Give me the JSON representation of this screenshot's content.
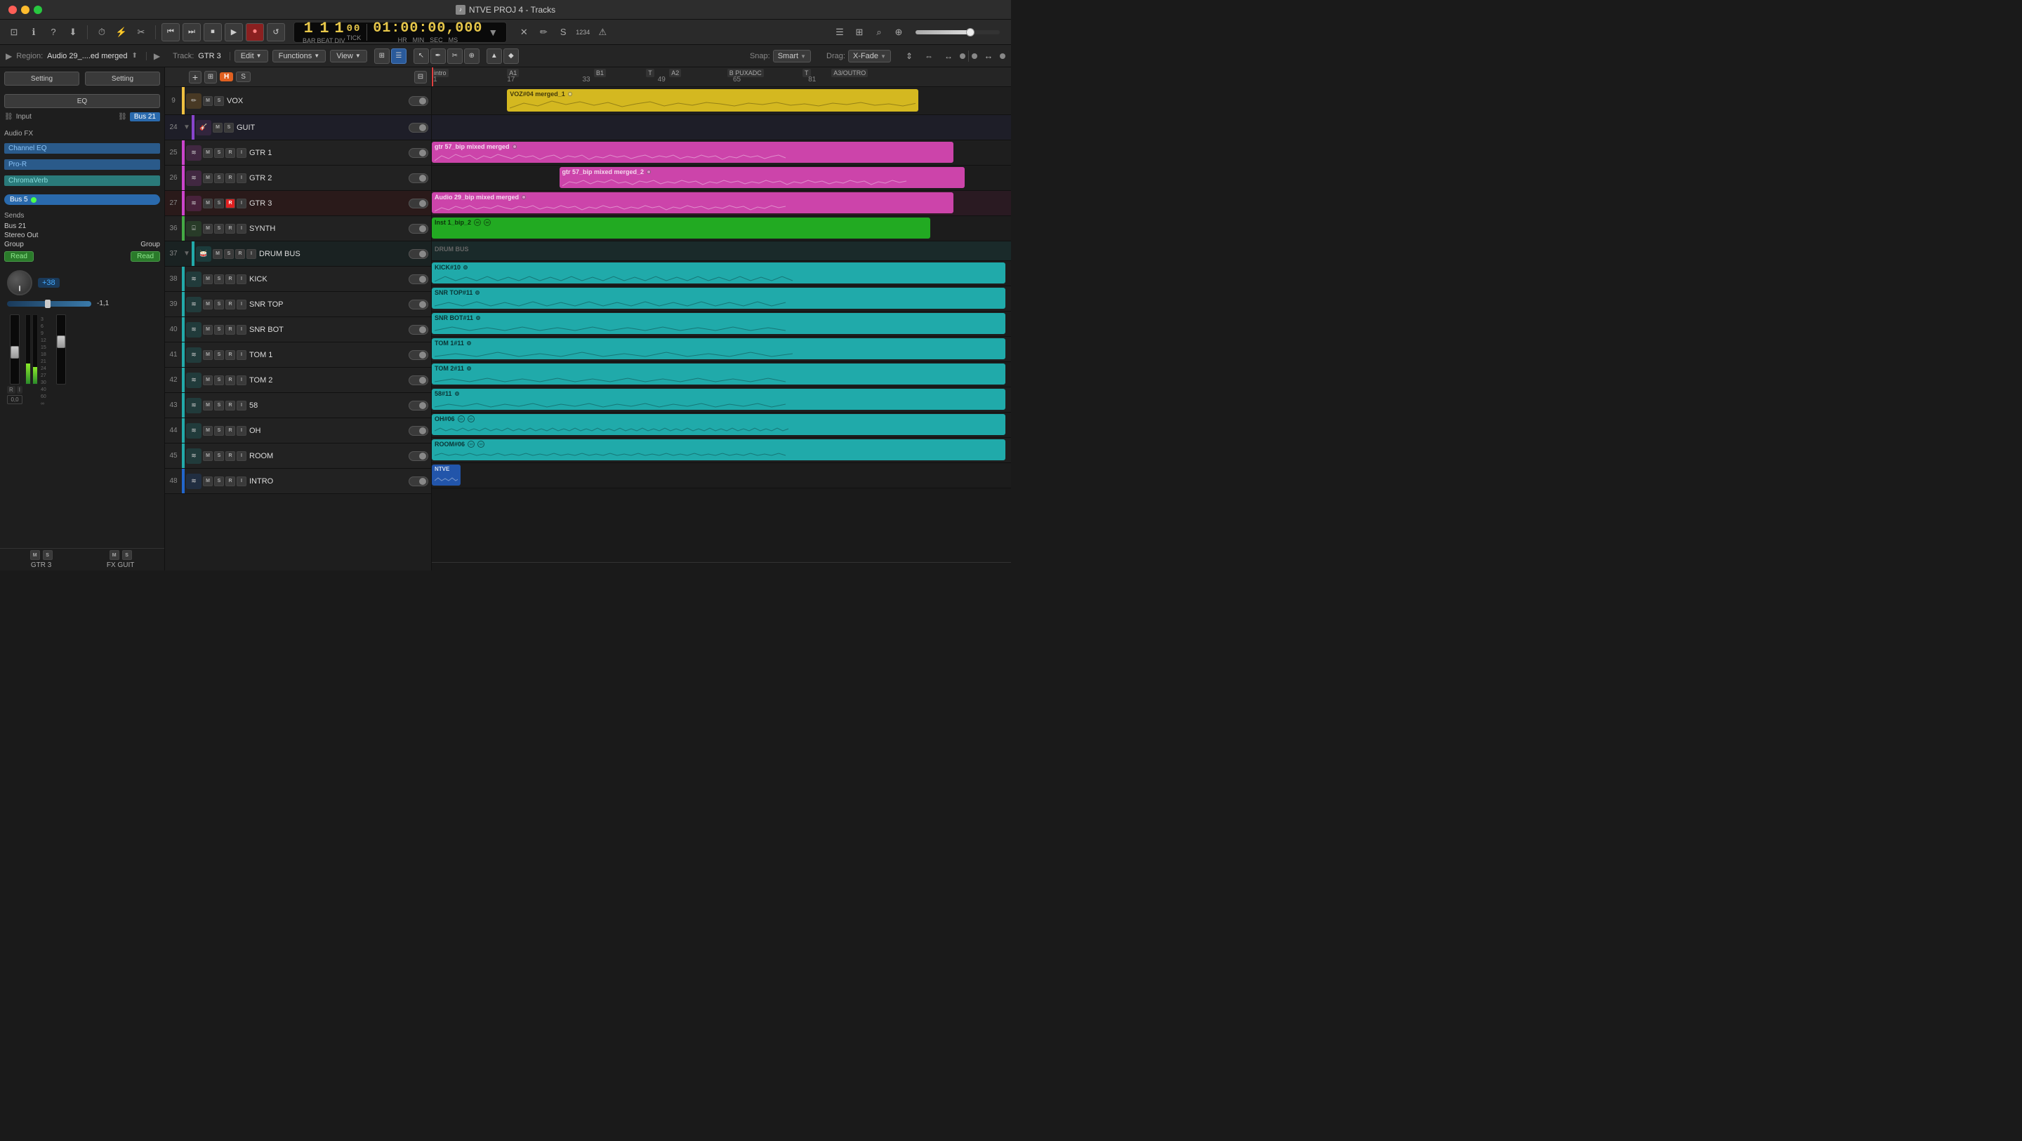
{
  "app": {
    "title": "NTVE PROJ 4 - Tracks"
  },
  "titleBar": {
    "title": "NTVE PROJ 4 - Tracks"
  },
  "transport": {
    "bar": "1",
    "beat": "1",
    "div": "1",
    "tick": "00",
    "time": "01:00:00,000",
    "bar_label": "BAR",
    "beat_label": "BEAT",
    "div_label": "DIV",
    "tick_label": "TICK",
    "hr_label": "HR",
    "min_label": "MIN",
    "sec_label": "SEC",
    "ms_label": "MS"
  },
  "controlBar": {
    "region_label": "Region:",
    "region_name": "Audio 29_....ed merged",
    "track_label": "Track:",
    "track_name": "GTR 3",
    "edit": "Edit",
    "functions": "Functions",
    "view": "View",
    "snap_label": "Snap:",
    "snap_value": "Smart",
    "drag_label": "Drag:",
    "drag_value": "X-Fade"
  },
  "leftPanel": {
    "setting1": "Setting",
    "setting2": "Setting",
    "eq": "EQ",
    "input_label": "Input",
    "bus_21": "Bus 21",
    "audio_fx": "Audio FX",
    "channel_eq": "Channel EQ",
    "pro_r": "Pro-R",
    "chromaverb": "ChromaVerb",
    "bus_5": "Bus 5",
    "sends": "Sends",
    "bus_21_send": "Bus 21",
    "stereo_out": "Stereo Out",
    "group": "Group",
    "group2": "Group",
    "read1": "Read",
    "read2": "Read",
    "gain": "+38",
    "pan": "-1,1",
    "pan2": "0,0",
    "track_bottom": "GTR 3",
    "fx_bottom": "FX GUIT",
    "m": "M",
    "s": "S",
    "m2": "M",
    "s2": "S"
  },
  "trackHeader": {
    "h_label": "H",
    "s_label": "S"
  },
  "tracks": [
    {
      "num": "9",
      "color": "#f0c040",
      "icon_type": "pencil",
      "icon_color": "#f0a030",
      "name": "VOX",
      "mute": false,
      "solo": false,
      "rec": false,
      "input": false,
      "on": false,
      "has_rec": false,
      "has_input": false,
      "has_expand": false
    },
    {
      "num": "24",
      "color": "#8844cc",
      "icon_type": "guitar",
      "icon_color": "#cc66ff",
      "name": "GUIT",
      "mute": false,
      "solo": false,
      "rec": false,
      "input": false,
      "on": false,
      "has_expand": true
    },
    {
      "num": "25",
      "color": "#cc44cc",
      "icon_type": "wave",
      "icon_color": "#cc44cc",
      "name": "GTR 1",
      "mute": false,
      "solo": false,
      "rec": false,
      "input": false,
      "on": false,
      "has_rec": true,
      "has_input": true
    },
    {
      "num": "26",
      "color": "#cc44cc",
      "icon_type": "wave",
      "icon_color": "#cc44cc",
      "name": "GTR 2",
      "mute": false,
      "solo": false,
      "rec": false,
      "input": false,
      "on": false,
      "has_rec": true,
      "has_input": true
    },
    {
      "num": "27",
      "color": "#cc44cc",
      "icon_type": "wave",
      "icon_color": "#cc44cc",
      "name": "GTR 3",
      "mute": false,
      "solo": false,
      "rec": true,
      "input": false,
      "on": false,
      "has_rec": true,
      "has_input": true
    },
    {
      "num": "36",
      "color": "#44aa44",
      "icon_type": "synth",
      "icon_color": "#44aa44",
      "name": "SYNTH",
      "mute": false,
      "solo": false,
      "rec": false,
      "input": false,
      "on": false,
      "has_rec": true,
      "has_input": true
    },
    {
      "num": "37",
      "color": "#22aaaa",
      "icon_type": "drum",
      "icon_color": "#22aaaa",
      "name": "DRUM BUS",
      "mute": false,
      "solo": false,
      "rec": false,
      "input": false,
      "on": false,
      "has_rec": true,
      "has_input": true,
      "has_expand": true
    },
    {
      "num": "38",
      "color": "#22aaaa",
      "icon_type": "wave",
      "icon_color": "#22aaaa",
      "name": "KICK",
      "mute": false,
      "solo": false,
      "rec": false,
      "input": false,
      "on": false,
      "has_rec": true,
      "has_input": true
    },
    {
      "num": "39",
      "color": "#22aaaa",
      "icon_type": "wave",
      "icon_color": "#22aaaa",
      "name": "SNR TOP",
      "mute": false,
      "solo": false,
      "rec": false,
      "input": false,
      "on": false,
      "has_rec": true,
      "has_input": true
    },
    {
      "num": "40",
      "color": "#22aaaa",
      "icon_type": "wave",
      "icon_color": "#22aaaa",
      "name": "SNR BOT",
      "mute": false,
      "solo": false,
      "rec": false,
      "input": false,
      "on": false,
      "has_rec": true,
      "has_input": true
    },
    {
      "num": "41",
      "color": "#22aaaa",
      "icon_type": "wave",
      "icon_color": "#22aaaa",
      "name": "TOM 1",
      "mute": false,
      "solo": false,
      "rec": false,
      "input": false,
      "on": false,
      "has_rec": true,
      "has_input": true
    },
    {
      "num": "42",
      "color": "#22aaaa",
      "icon_type": "wave",
      "icon_color": "#22aaaa",
      "name": "TOM 2",
      "mute": false,
      "solo": false,
      "rec": false,
      "input": false,
      "on": false,
      "has_rec": true,
      "has_input": true
    },
    {
      "num": "43",
      "color": "#22aaaa",
      "icon_type": "wave",
      "icon_color": "#22aaaa",
      "name": "58",
      "mute": false,
      "solo": false,
      "rec": false,
      "input": false,
      "on": false,
      "has_rec": true,
      "has_input": true
    },
    {
      "num": "44",
      "color": "#22aaaa",
      "icon_type": "wave",
      "icon_color": "#22aaaa",
      "name": "OH",
      "mute": false,
      "solo": false,
      "rec": false,
      "input": false,
      "on": false,
      "has_rec": true,
      "has_input": true
    },
    {
      "num": "45",
      "color": "#22aaaa",
      "icon_type": "wave",
      "icon_color": "#22aaaa",
      "name": "ROOM",
      "mute": false,
      "solo": false,
      "rec": false,
      "input": false,
      "on": false,
      "has_rec": true,
      "has_input": true
    },
    {
      "num": "48",
      "color": "#2266cc",
      "icon_type": "wave",
      "icon_color": "#2266cc",
      "name": "INTRO",
      "mute": false,
      "solo": false,
      "rec": false,
      "input": false,
      "on": false,
      "has_rec": true,
      "has_input": true
    }
  ],
  "timeline": {
    "markers": [
      "1",
      "17",
      "33",
      "49",
      "65",
      "81"
    ],
    "sections": [
      {
        "label": "intro",
        "position": 0
      },
      {
        "label": "A1",
        "position": 14.5
      },
      {
        "label": "B1",
        "position": 31
      },
      {
        "label": "T",
        "position": 38.5
      },
      {
        "label": "A2",
        "position": 42
      },
      {
        "label": "B PUXADC",
        "position": 53.5
      },
      {
        "label": "T",
        "position": 66
      },
      {
        "label": "A3/OUTRO",
        "position": 72
      }
    ]
  },
  "regions": [
    {
      "lane": 0,
      "label": "VOZ#04 merged_1",
      "color": "#d4b820",
      "left": "14.5%",
      "width": "70%",
      "dot": true
    },
    {
      "lane": 2,
      "label": "gtr 57_bip mixed merged",
      "color": "#cc44aa",
      "left": "0%",
      "width": "90%",
      "dot": true
    },
    {
      "lane": 3,
      "label": "gtr 57_bip mixed merged_2",
      "color": "#cc44aa",
      "left": "23%",
      "width": "70%",
      "dot": true
    },
    {
      "lane": 4,
      "label": "Audio 29_bip mixed merged",
      "color": "#cc44aa",
      "left": "0%",
      "width": "90%",
      "dot": true
    },
    {
      "lane": 5,
      "label": "Inst 1_bip_2",
      "color": "#22aa22",
      "left": "0%",
      "width": "85%",
      "loop": true
    },
    {
      "lane": 7,
      "label": "KICK#10",
      "color": "#20aaaa",
      "left": "0%",
      "width": "98%",
      "dot": true
    },
    {
      "lane": 8,
      "label": "SNR TOP#11",
      "color": "#20aaaa",
      "left": "0%",
      "width": "98%",
      "dot": true
    },
    {
      "lane": 9,
      "label": "SNR BOT#11",
      "color": "#20aaaa",
      "left": "0%",
      "width": "98%",
      "dot": true
    },
    {
      "lane": 10,
      "label": "TOM 1#11",
      "color": "#20aaaa",
      "left": "0%",
      "width": "98%",
      "dot": true
    },
    {
      "lane": 11,
      "label": "TOM 2#11",
      "color": "#20aaaa",
      "left": "0%",
      "width": "98%",
      "dot": true
    },
    {
      "lane": 12,
      "label": "58#11",
      "color": "#20aaaa",
      "left": "0%",
      "width": "98%",
      "dot": true
    },
    {
      "lane": 13,
      "label": "OH#06",
      "color": "#20aaaa",
      "left": "0%",
      "width": "98%",
      "loop": true
    },
    {
      "lane": 14,
      "label": "ROOM#06",
      "color": "#20aaaa",
      "left": "0%",
      "width": "98%",
      "loop": true
    },
    {
      "lane": 15,
      "label": "NTVE",
      "color": "#2255aa",
      "left": "0%",
      "width": "4.5%",
      "dot": false
    }
  ]
}
